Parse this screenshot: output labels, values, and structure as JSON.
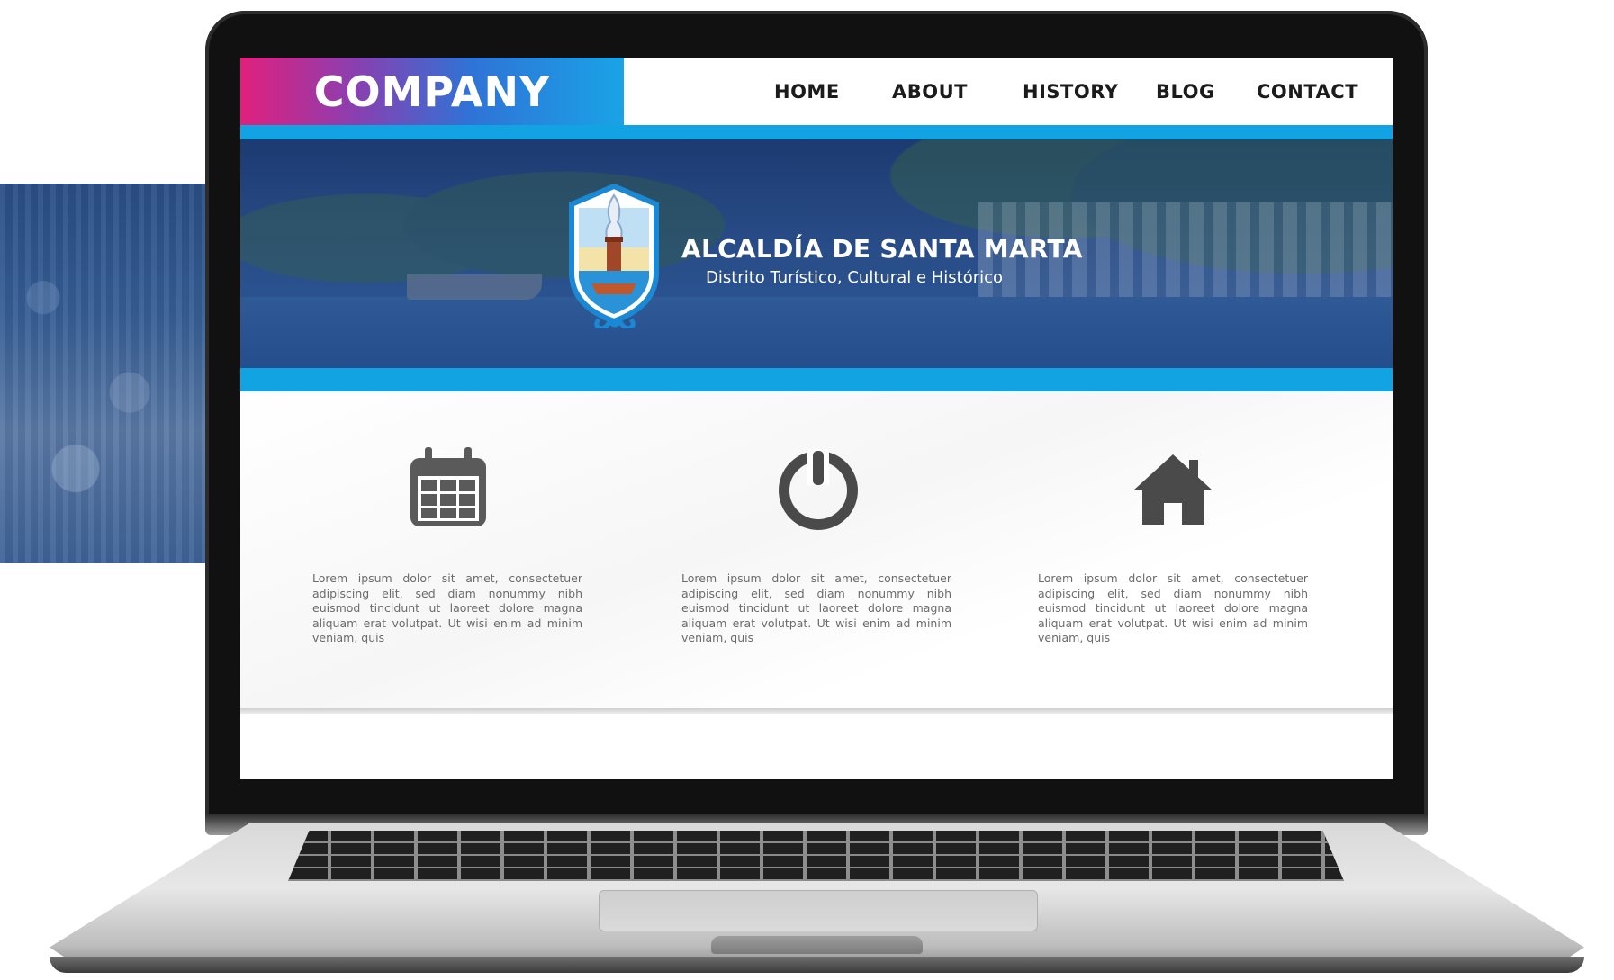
{
  "header": {
    "brand": "COMPANY",
    "nav": [
      {
        "label": "HOME"
      },
      {
        "label": "ABOUT"
      },
      {
        "label": "HISTORY"
      },
      {
        "label": "BLOG"
      },
      {
        "label": "CONTACT"
      }
    ]
  },
  "hero": {
    "title": "ALCALDÍA DE SANTA MARTA",
    "subtitle": "Distrito Turístico, Cultural e Histórico"
  },
  "features": [
    {
      "icon": "calendar-icon",
      "text": "Lorem ipsum dolor sit amet, consectetuer adipiscing elit, sed diam nonummy nibh euismod tincidunt ut laoreet dolore magna aliquam erat volutpat. Ut wisi enim ad minim veniam, quis"
    },
    {
      "icon": "power-icon",
      "text": "Lorem ipsum dolor sit amet, consectetuer adipiscing elit, sed diam nonummy nibh euismod tincidunt ut laoreet dolore magna aliquam erat volutpat. Ut wisi enim ad minim veniam, quis"
    },
    {
      "icon": "home-icon",
      "text": "Lorem ipsum dolor sit amet, consectetuer adipiscing elit, sed diam nonummy nibh euismod tincidunt ut laoreet dolore magna aliquam erat volutpat. Ut wisi enim ad minim veniam, quis"
    }
  ],
  "colors": {
    "accent_blue": "#12a4e2",
    "brand_pink": "#e0207d",
    "hero_navy": "#1d3a72",
    "icon_gray": "#5a5a5a"
  }
}
